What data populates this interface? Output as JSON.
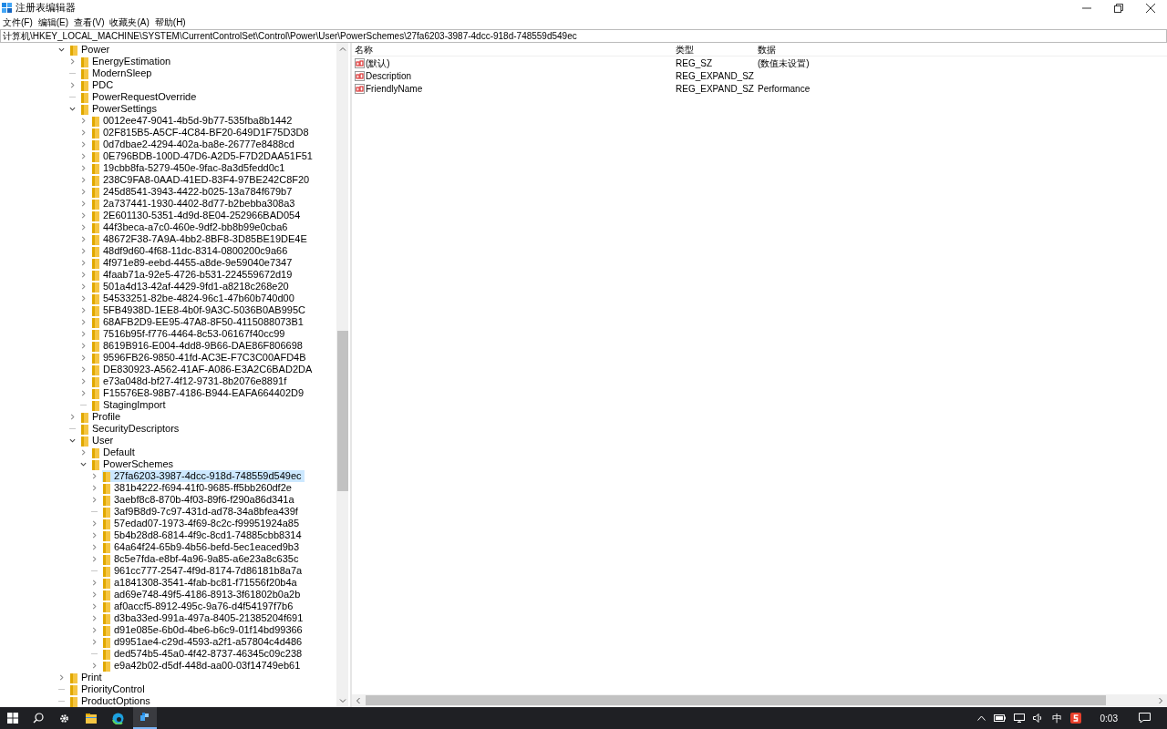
{
  "window": {
    "title": "注册表编辑器"
  },
  "menu": [
    {
      "label": "文件(F)"
    },
    {
      "label": "编辑(E)"
    },
    {
      "label": "查看(V)"
    },
    {
      "label": "收藏夹(A)"
    },
    {
      "label": "帮助(H)"
    }
  ],
  "address": "计算机\\HKEY_LOCAL_MACHINE\\SYSTEM\\CurrentControlSet\\Control\\Power\\User\\PowerSchemes\\27fa6203-3987-4dcc-918d-748559d549ec",
  "tree": [
    {
      "name": "Power",
      "kind": "expanded",
      "selected": false,
      "children": [
        {
          "name": "EnergyEstimation",
          "kind": "collapsed",
          "selected": false
        },
        {
          "name": "ModernSleep",
          "kind": "leaf",
          "selected": false
        },
        {
          "name": "PDC",
          "kind": "collapsed",
          "selected": false
        },
        {
          "name": "PowerRequestOverride",
          "kind": "leaf",
          "selected": false
        },
        {
          "name": "PowerSettings",
          "kind": "expanded",
          "selected": false,
          "children": [
            {
              "name": "0012ee47-9041-4b5d-9b77-535fba8b1442",
              "kind": "collapsed",
              "selected": false
            },
            {
              "name": "02F815B5-A5CF-4C84-BF20-649D1F75D3D8",
              "kind": "collapsed",
              "selected": false
            },
            {
              "name": "0d7dbae2-4294-402a-ba8e-26777e8488cd",
              "kind": "collapsed",
              "selected": false
            },
            {
              "name": "0E796BDB-100D-47D6-A2D5-F7D2DAA51F51",
              "kind": "collapsed",
              "selected": false
            },
            {
              "name": "19cbb8fa-5279-450e-9fac-8a3d5fedd0c1",
              "kind": "collapsed",
              "selected": false
            },
            {
              "name": "238C9FA8-0AAD-41ED-83F4-97BE242C8F20",
              "kind": "collapsed",
              "selected": false
            },
            {
              "name": "245d8541-3943-4422-b025-13a784f679b7",
              "kind": "collapsed",
              "selected": false
            },
            {
              "name": "2a737441-1930-4402-8d77-b2bebba308a3",
              "kind": "collapsed",
              "selected": false
            },
            {
              "name": "2E601130-5351-4d9d-8E04-252966BAD054",
              "kind": "collapsed",
              "selected": false
            },
            {
              "name": "44f3beca-a7c0-460e-9df2-bb8b99e0cba6",
              "kind": "collapsed",
              "selected": false
            },
            {
              "name": "48672F38-7A9A-4bb2-8BF8-3D85BE19DE4E",
              "kind": "collapsed",
              "selected": false
            },
            {
              "name": "48df9d60-4f68-11dc-8314-0800200c9a66",
              "kind": "collapsed",
              "selected": false
            },
            {
              "name": "4f971e89-eebd-4455-a8de-9e59040e7347",
              "kind": "collapsed",
              "selected": false
            },
            {
              "name": "4faab71a-92e5-4726-b531-224559672d19",
              "kind": "collapsed",
              "selected": false
            },
            {
              "name": "501a4d13-42af-4429-9fd1-a8218c268e20",
              "kind": "collapsed",
              "selected": false
            },
            {
              "name": "54533251-82be-4824-96c1-47b60b740d00",
              "kind": "collapsed",
              "selected": false
            },
            {
              "name": "5FB4938D-1EE8-4b0f-9A3C-5036B0AB995C",
              "kind": "collapsed",
              "selected": false
            },
            {
              "name": "68AFB2D9-EE95-47A8-8F50-4115088073B1",
              "kind": "collapsed",
              "selected": false
            },
            {
              "name": "7516b95f-f776-4464-8c53-06167f40cc99",
              "kind": "collapsed",
              "selected": false
            },
            {
              "name": "8619B916-E004-4dd8-9B66-DAE86F806698",
              "kind": "collapsed",
              "selected": false
            },
            {
              "name": "9596FB26-9850-41fd-AC3E-F7C3C00AFD4B",
              "kind": "collapsed",
              "selected": false
            },
            {
              "name": "DE830923-A562-41AF-A086-E3A2C6BAD2DA",
              "kind": "collapsed",
              "selected": false
            },
            {
              "name": "e73a048d-bf27-4f12-9731-8b2076e8891f",
              "kind": "collapsed",
              "selected": false
            },
            {
              "name": "F15576E8-98B7-4186-B944-EAFA664402D9",
              "kind": "collapsed",
              "selected": false
            },
            {
              "name": "StagingImport",
              "kind": "leaf",
              "selected": false
            }
          ]
        },
        {
          "name": "Profile",
          "kind": "collapsed",
          "selected": false
        },
        {
          "name": "SecurityDescriptors",
          "kind": "leaf",
          "selected": false
        },
        {
          "name": "User",
          "kind": "expanded",
          "selected": false,
          "children": [
            {
              "name": "Default",
              "kind": "collapsed",
              "selected": false
            },
            {
              "name": "PowerSchemes",
              "kind": "expanded",
              "selected": false,
              "children": [
                {
                  "name": "27fa6203-3987-4dcc-918d-748559d549ec",
                  "kind": "collapsed",
                  "selected": true
                },
                {
                  "name": "381b4222-f694-41f0-9685-ff5bb260df2e",
                  "kind": "collapsed",
                  "selected": false
                },
                {
                  "name": "3aebf8c8-870b-4f03-89f6-f290a86d341a",
                  "kind": "collapsed",
                  "selected": false
                },
                {
                  "name": "3af9B8d9-7c97-431d-ad78-34a8bfea439f",
                  "kind": "leaf",
                  "selected": false
                },
                {
                  "name": "57edad07-1973-4f69-8c2c-f99951924a85",
                  "kind": "collapsed",
                  "selected": false
                },
                {
                  "name": "5b4b28d8-6814-4f9c-8cd1-74885cbb8314",
                  "kind": "collapsed",
                  "selected": false
                },
                {
                  "name": "64a64f24-65b9-4b56-befd-5ec1eaced9b3",
                  "kind": "collapsed",
                  "selected": false
                },
                {
                  "name": "8c5e7fda-e8bf-4a96-9a85-a6e23a8c635c",
                  "kind": "collapsed",
                  "selected": false
                },
                {
                  "name": "961cc777-2547-4f9d-8174-7d86181b8a7a",
                  "kind": "leaf",
                  "selected": false
                },
                {
                  "name": "a1841308-3541-4fab-bc81-f71556f20b4a",
                  "kind": "collapsed",
                  "selected": false
                },
                {
                  "name": "ad69e748-49f5-4186-8913-3f61802b0a2b",
                  "kind": "collapsed",
                  "selected": false
                },
                {
                  "name": "af0accf5-8912-495c-9a76-d4f54197f7b6",
                  "kind": "collapsed",
                  "selected": false
                },
                {
                  "name": "d3ba33ed-991a-497a-8405-21385204f691",
                  "kind": "collapsed",
                  "selected": false
                },
                {
                  "name": "d91e085e-6b0d-4be6-b6c9-01f14bd99366",
                  "kind": "collapsed",
                  "selected": false
                },
                {
                  "name": "d9951ae4-c29d-4593-a2f1-a57804c4d486",
                  "kind": "collapsed",
                  "selected": false
                },
                {
                  "name": "ded574b5-45a0-4f42-8737-46345c09c238",
                  "kind": "leaf",
                  "selected": false
                },
                {
                  "name": "e9a42b02-d5df-448d-aa00-03f14749eb61",
                  "kind": "collapsed",
                  "selected": false
                }
              ]
            }
          ]
        }
      ]
    },
    {
      "name": "Print",
      "kind": "collapsed",
      "selected": false
    },
    {
      "name": "PriorityControl",
      "kind": "leaf",
      "selected": false
    },
    {
      "name": "ProductOptions",
      "kind": "leaf",
      "selected": false
    }
  ],
  "values": {
    "columns": [
      "名称",
      "类型",
      "数据"
    ],
    "rows": [
      {
        "name": "(默认)",
        "type": "REG_SZ",
        "data": "(数值未设置)"
      },
      {
        "name": "Description",
        "type": "REG_EXPAND_SZ"
      },
      {
        "name": "FriendlyName",
        "type": "REG_EXPAND_SZ",
        "data": "Performance"
      }
    ]
  },
  "taskbar": {
    "ime": "中",
    "clock": "0:03"
  }
}
